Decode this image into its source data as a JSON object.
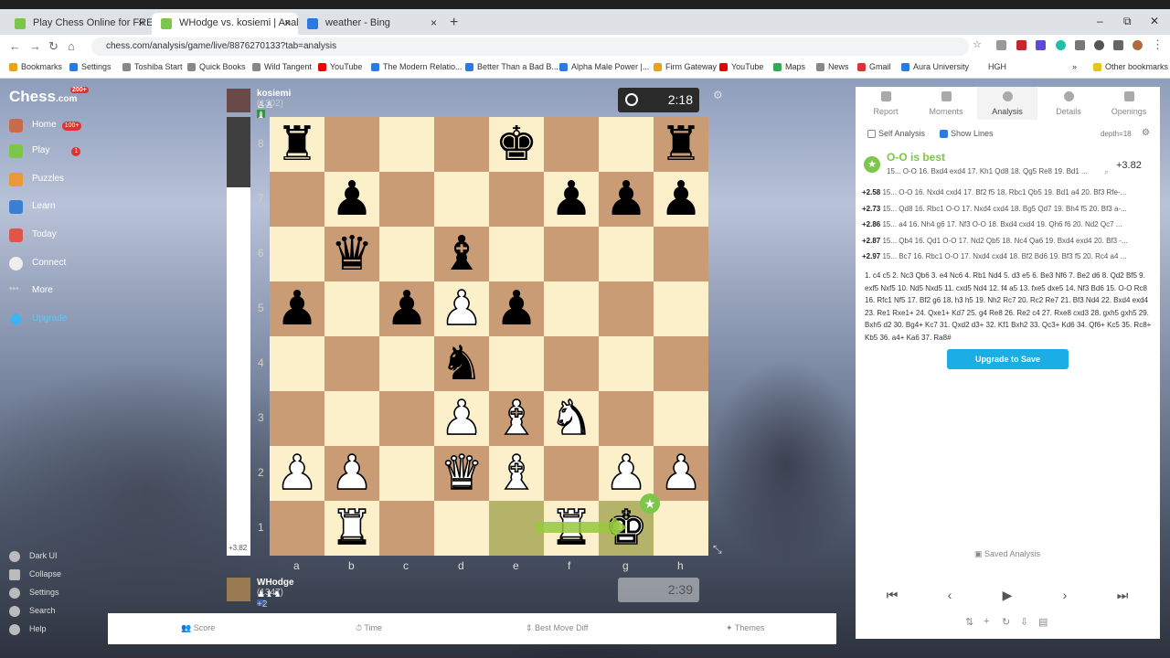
{
  "browser": {
    "tabs": [
      {
        "title": "Play Chess Online for FREE with F",
        "close": "×"
      },
      {
        "title": "WHodge vs. kosiemi | Analysis -",
        "close": "×"
      },
      {
        "title": "weather - Bing",
        "close": "×"
      }
    ],
    "new_tab": "+",
    "url": "chess.com/analysis/game/live/8876270133?tab=analysis",
    "bookmarks": [
      "Bookmarks",
      "Settings",
      "Toshiba Start",
      "Quick Books",
      "Wild Tangent",
      "YouTube",
      "The Modern Relatio...",
      "Better Than a Bad B...",
      "Alpha Male Power |...",
      "Firm Gateway",
      "YouTube",
      "Maps",
      "News",
      "Gmail",
      "Aura University",
      "HGH"
    ],
    "other_bookmarks": "Other bookmarks",
    "window_controls": [
      "–",
      "⧉",
      "✕"
    ]
  },
  "sidebar": {
    "logo": "Chess",
    "logo_suffix": ".com",
    "logo_badge": "200+",
    "items": [
      {
        "label": "Home",
        "badge": "100+"
      },
      {
        "label": "Play",
        "badge": "1"
      },
      {
        "label": "Puzzles"
      },
      {
        "label": "Learn"
      },
      {
        "label": "Today"
      },
      {
        "label": "Connect"
      },
      {
        "label": "More"
      },
      {
        "label": "Upgrade"
      }
    ],
    "settings_items": [
      "Dark UI",
      "Collapse",
      "Settings",
      "Search",
      "Help"
    ]
  },
  "players": {
    "top": {
      "name": "kosiemi",
      "rating": "(1302)",
      "clock": "2:18"
    },
    "bottom": {
      "name": "WHodge",
      "rating": "(1347)",
      "extra": "+2",
      "clock": "2:39"
    }
  },
  "eval_bar": {
    "score": "+3.82",
    "black_fraction": 0.16
  },
  "board": {
    "files": [
      "a",
      "b",
      "c",
      "d",
      "e",
      "f",
      "g",
      "h"
    ],
    "ranks": [
      "8",
      "7",
      "6",
      "5",
      "4",
      "3",
      "2",
      "1"
    ],
    "rows": [
      [
        "bR",
        "",
        "",
        "",
        "bK",
        "",
        "",
        "bR"
      ],
      [
        "",
        "bP",
        "",
        "",
        "",
        "bP",
        "bP",
        "bP"
      ],
      [
        "",
        "bQ",
        "",
        "bB",
        "",
        "",
        "",
        ""
      ],
      [
        "bP",
        "",
        "bP",
        "wP",
        "bP",
        "",
        "",
        ""
      ],
      [
        "",
        "",
        "",
        "bN",
        "",
        "",
        "",
        ""
      ],
      [
        "",
        "",
        "",
        "wP",
        "wB",
        "wN",
        "",
        ""
      ],
      [
        "wP",
        "wP",
        "",
        "wQ",
        "wB",
        "",
        "wP",
        "wP"
      ],
      [
        "",
        "wR",
        "",
        "",
        "",
        "wR",
        "wK",
        ""
      ]
    ],
    "highlight": [
      "e1",
      "g1"
    ]
  },
  "bottom_bar": [
    "Score",
    "Time",
    "Best Move Diff",
    "Themes"
  ],
  "panel": {
    "tabs": [
      "Report",
      "Moments",
      "Analysis",
      "Details",
      "Openings"
    ],
    "active_tab": "Analysis",
    "self_analysis": "Self Analysis",
    "show_lines": "Show Lines",
    "depth": "depth=18",
    "best_move": "O-O is best",
    "best_line": "15... O-O 16. Bxd4 exd4 17. Kh1 Qd8 18. Qg5 Re8 19. Bd1 ...",
    "best_score": "+3.82",
    "lines": [
      {
        "score": "+2.58",
        "text": "15... O-O 16. Nxd4 cxd4 17. Bf2 f5 18. Rbc1 Qb5 19. Bd1 a4 20. Bf3 Rfe-..."
      },
      {
        "score": "+2.73",
        "text": "15... Qd8 16. Rbc1 O-O 17. Nxd4 cxd4 18. Bg5 Qd7 19. Bh4 f5 20. Bf3 a-..."
      },
      {
        "score": "+2.86",
        "text": "15... a4 16. Nh4 g6 17. Nf3 O-O 18. Bxd4 cxd4 19. Qh6 f6 20. Nd2 Qc7 ..."
      },
      {
        "score": "+2.87",
        "text": "15... Qb4 16. Qd1 O-O 17. Nd2 Qb5 18. Nc4 Qa6 19. Bxd4 exd4 20. Bf3 -..."
      },
      {
        "score": "+2.97",
        "text": "15... Bc7 16. Rbc1 O-O 17. Nxd4 cxd4 18. Bf2 Bd6 19. Bf3 f5 20. Rc4 a4 ..."
      }
    ],
    "moves": "1. c4 c5 2. Nc3 Qb6 3. e4 Nc6 4. Rb1 Nd4 5. d3 e5 6. Be3 Nf6 7. Be2 d6 8. Qd2 Bf5 9. exf5 Nxf5 10. Nd5 Nxd5 11. cxd5 Nd4 12. f4 a5 13. fxe5 dxe5 14. Nf3 Bd6 15. O-O Rc8 16. Rfc1 Nf5 17. Bf2 g6 18. h3 h5 19. Nh2 Rc7 20. Rc2 Re7 21. Bf3 Nd4 22. Bxd4 exd4 23. Re1 Rxe1+ 24. Qxe1+ Kd7 25. g4 Re8 26. Re2 c4 27. Rxe8 cxd3 28. gxh5 gxh5 29. Bxh5 d2 30. Bg4+ Kc7 31. Qxd2 d3+ 32. Kf1 Bxh2 33. Qc3+ Kd6 34. Qf6+ Kc5 35. Rc8+ Kb5 36. a4+ Ka6 37. Ra8#",
    "upgrade": "Upgrade to Save",
    "saved": "Saved Analysis",
    "controls": [
      "⏮",
      "‹",
      "▶",
      "›",
      "⏭"
    ],
    "tools": [
      "⇅",
      "+",
      "↻",
      "⇩",
      "▤"
    ]
  },
  "colors": {
    "light_square": "#fbf0c9",
    "dark_square": "#c99c76",
    "accent_green": "#7cc64b",
    "upgrade_blue": "#1baee5"
  }
}
